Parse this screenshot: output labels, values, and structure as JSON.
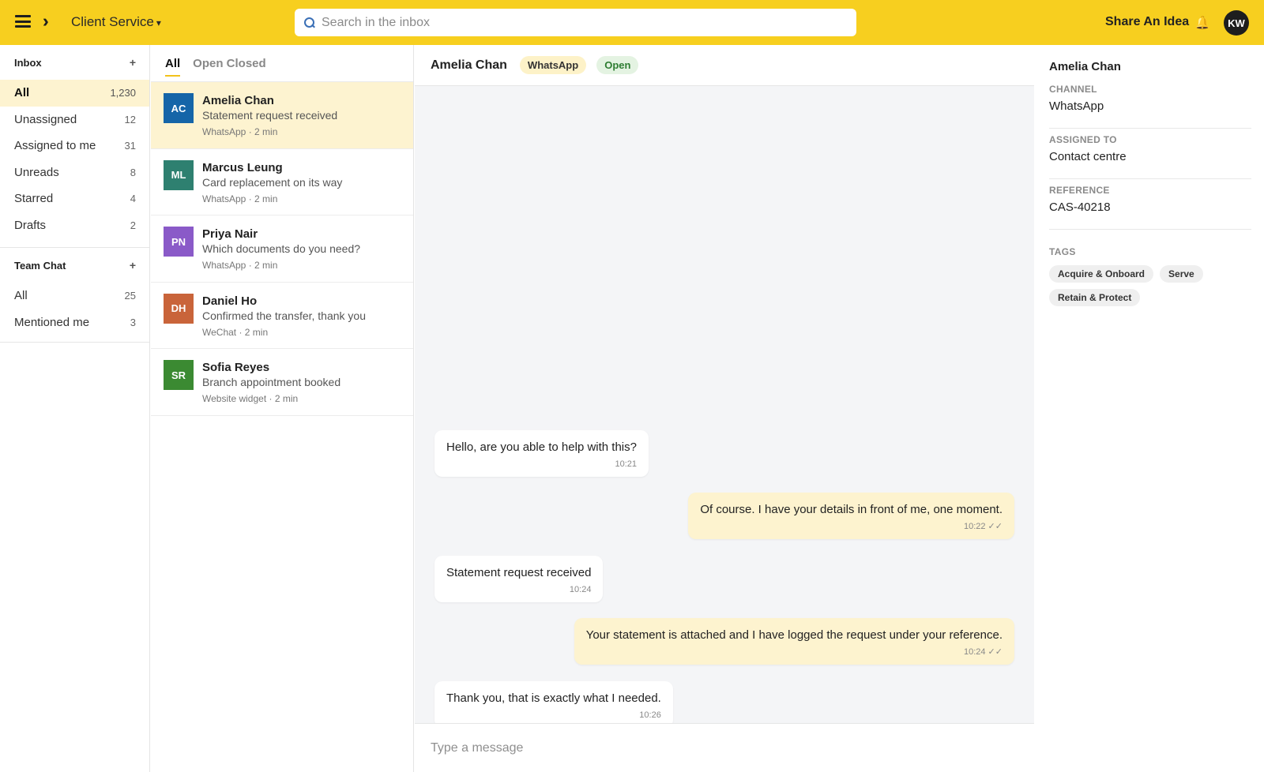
{
  "topbar": {
    "workspace": "Client Service",
    "workspace_caret": "▾",
    "search_placeholder": "Search in the inbox",
    "share_label": "Share An Idea",
    "bell_glyph": "🔔",
    "user_initials": "KW",
    "colors": {
      "bar": "#f7cf1f"
    }
  },
  "sidebar": {
    "inbox": {
      "title": "Inbox",
      "add": "+",
      "items": [
        {
          "label": "All",
          "count": "1,230",
          "active": true
        },
        {
          "label": "Unassigned",
          "count": "12"
        },
        {
          "label": "Assigned to me",
          "count": "31"
        },
        {
          "label": "Unreads",
          "count": "8"
        },
        {
          "label": "Starred",
          "count": "4"
        },
        {
          "label": "Drafts",
          "count": "2"
        }
      ]
    },
    "team_chat": {
      "title": "Team Chat",
      "add": "+",
      "items": [
        {
          "label": "All",
          "count": "25"
        },
        {
          "label": "Mentioned me",
          "count": "3"
        }
      ]
    }
  },
  "conversations": {
    "tabs": [
      {
        "label": "All",
        "active": true
      },
      {
        "label": "Open Closed"
      }
    ],
    "items": [
      {
        "initials": "AC",
        "color": "#1565a8",
        "name": "Amelia Chan",
        "preview": "Statement request received",
        "meta": "WhatsApp · 2 min",
        "active": true
      },
      {
        "initials": "ML",
        "color": "#2e8070",
        "name": "Marcus Leung",
        "preview": "Card replacement on its way",
        "meta": "WhatsApp · 2 min"
      },
      {
        "initials": "PN",
        "color": "#8a5ac8",
        "name": "Priya Nair",
        "preview": "Which documents do you need?",
        "meta": "WhatsApp · 2 min"
      },
      {
        "initials": "DH",
        "color": "#c9643a",
        "name": "Daniel Ho",
        "preview": "Confirmed the transfer, thank you",
        "meta": "WeChat · 2 min"
      },
      {
        "initials": "SR",
        "color": "#3b8a32",
        "name": "Sofia Reyes",
        "preview": "Branch appointment booked",
        "meta": "Website widget · 2 min"
      }
    ]
  },
  "chat": {
    "name": "Amelia Chan",
    "channel": "WhatsApp",
    "status": "Open",
    "messages": [
      {
        "dir": "in",
        "text": "Hello, are you able to help with this?",
        "time": "10:21"
      },
      {
        "dir": "out",
        "text": "Of course. I have your details in front of me, one moment.",
        "time": "10:22 ✓✓"
      },
      {
        "dir": "in",
        "text": "Statement request received",
        "time": "10:24"
      },
      {
        "dir": "out",
        "text": "Your statement is attached and I have logged the request under your reference.",
        "time": "10:24 ✓✓"
      },
      {
        "dir": "in",
        "text": "Thank you, that is exactly what I needed.",
        "time": "10:26"
      }
    ],
    "composer_placeholder": "Type a message"
  },
  "details": {
    "name": "Amelia Chan",
    "fields": [
      {
        "label": "CHANNEL",
        "value": "WhatsApp"
      },
      {
        "label": "ASSIGNED TO",
        "value": "Contact centre"
      },
      {
        "label": "REFERENCE",
        "value": "CAS-40218"
      }
    ],
    "tags_label": "TAGS",
    "tags": [
      "Acquire & Onboard",
      "Serve",
      "Retain & Protect"
    ]
  }
}
